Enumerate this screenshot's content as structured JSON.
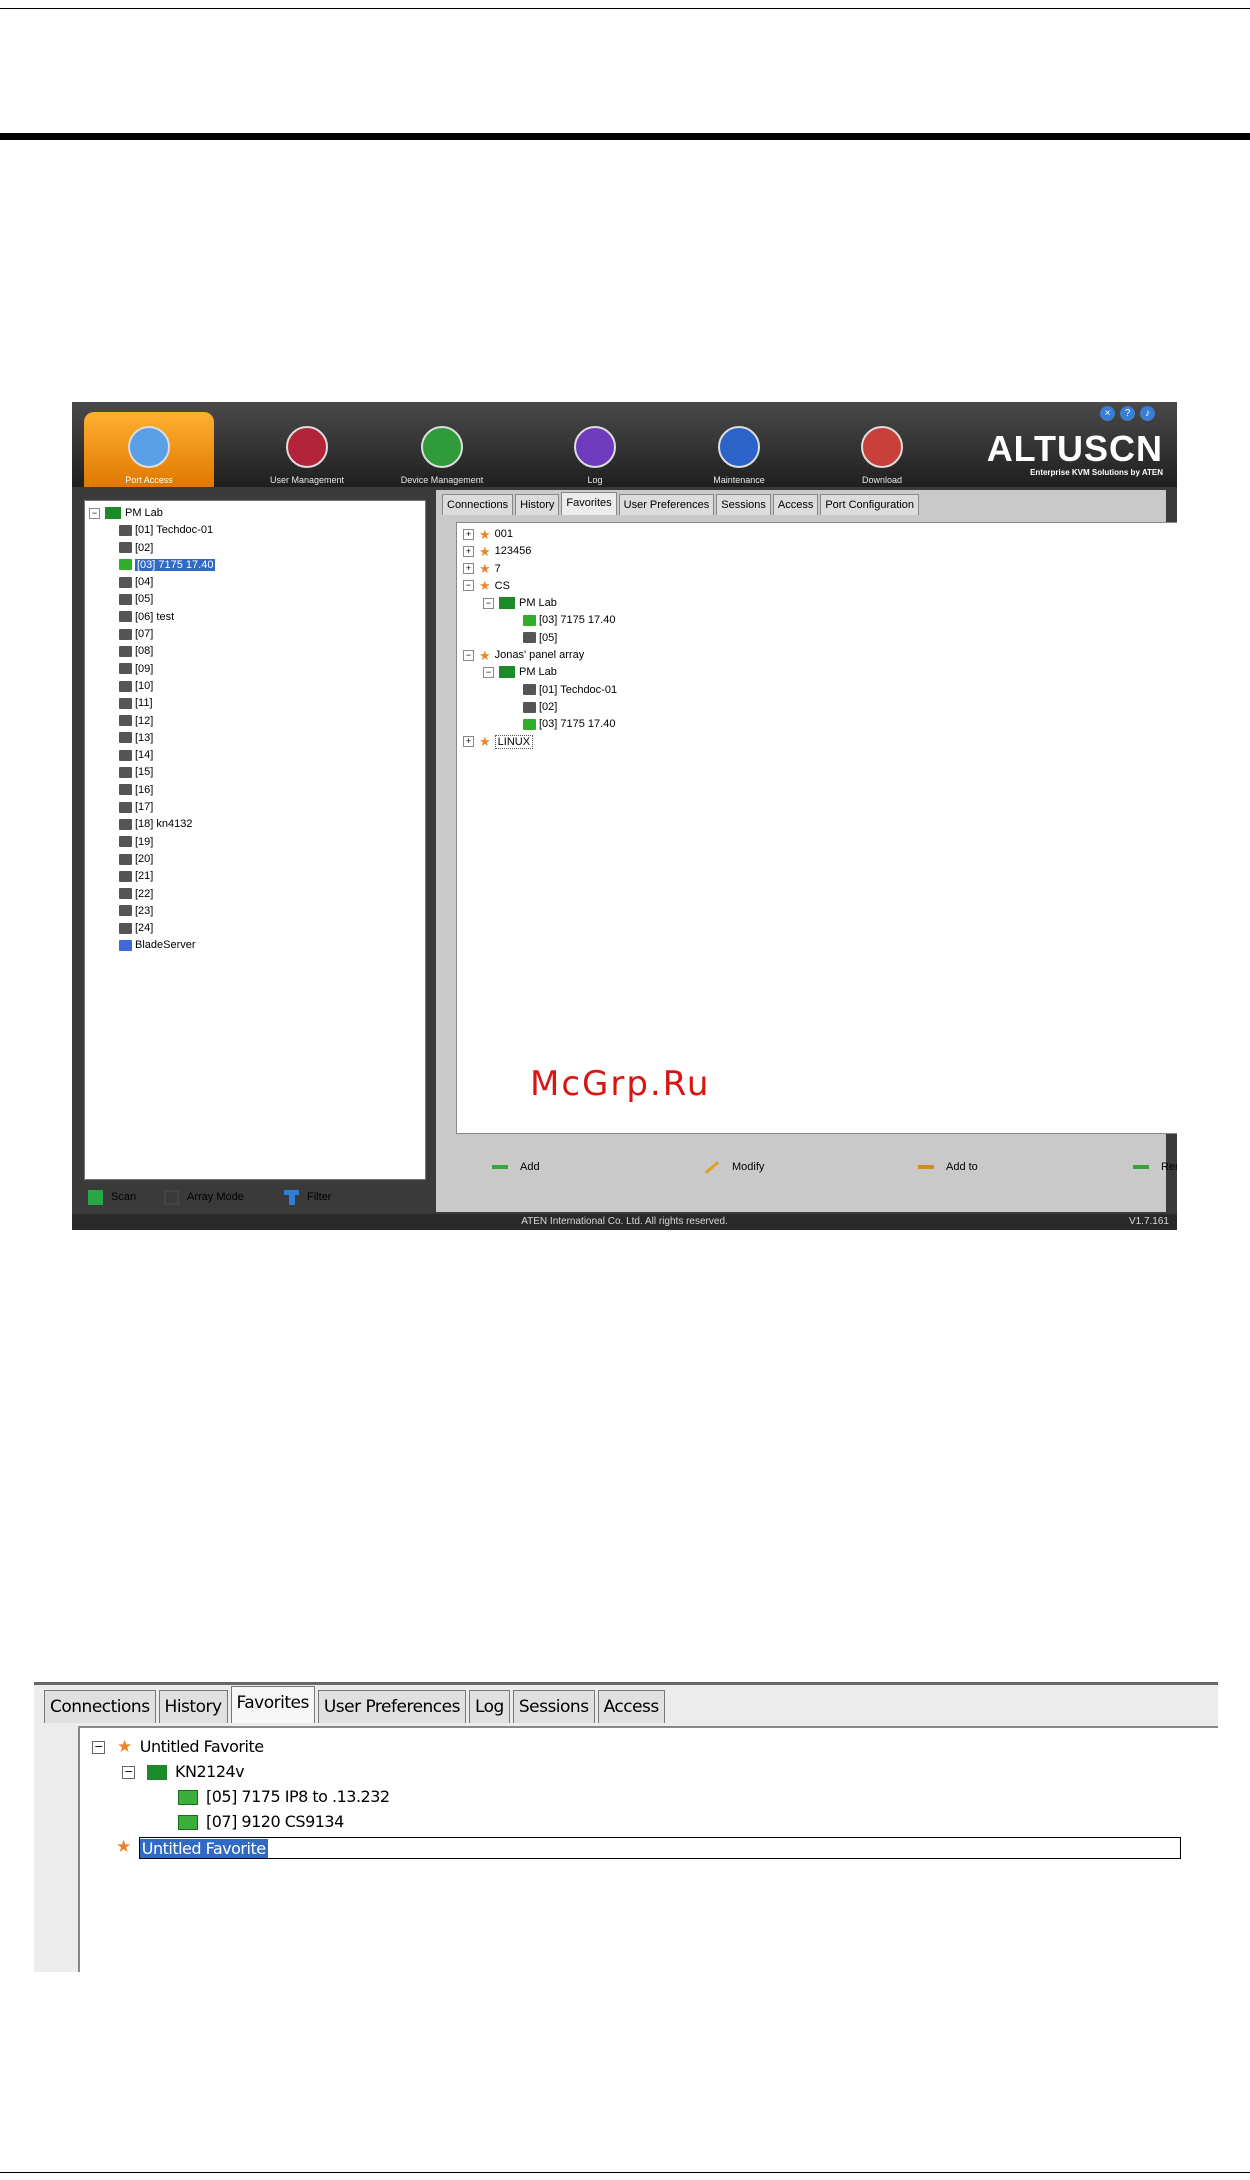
{
  "main_window": {
    "nav": [
      {
        "label": "Port Access",
        "active": true,
        "icon": "port-access-icon"
      },
      {
        "label": "User Management",
        "active": false,
        "icon": "user-management-icon"
      },
      {
        "label": "Device Management",
        "active": false,
        "icon": "device-management-icon"
      },
      {
        "label": "Log",
        "active": false,
        "icon": "log-icon"
      },
      {
        "label": "Maintenance",
        "active": false,
        "icon": "maintenance-icon"
      },
      {
        "label": "Download",
        "active": false,
        "icon": "download-icon"
      }
    ],
    "logo": {
      "name": "ALTUSCN",
      "tagline": "Enterprise KVM Solutions by ATEN"
    },
    "left_tree": {
      "root": "PM Lab",
      "ports": [
        "[01] Techdoc-01",
        "[02]",
        "[03] 7175 17.40",
        "[04]",
        "[05]",
        "[06] test",
        "[07]",
        "[08]",
        "[09]",
        "[10]",
        "[11]",
        "[12]",
        "[13]",
        "[14]",
        "[15]",
        "[16]",
        "[17]",
        "[18] kn4132",
        "[19]",
        "[20]",
        "[21]",
        "[22]",
        "[23]",
        "[24]"
      ],
      "blade": "BladeServer",
      "selected": "[03] 7175 17.40"
    },
    "left_actions": {
      "scan": "Scan",
      "array_mode": "Array Mode",
      "filter": "Filter"
    },
    "tabs": [
      "Connections",
      "History",
      "Favorites",
      "User Preferences",
      "Sessions",
      "Access",
      "Port Configuration"
    ],
    "active_tab": "Favorites",
    "favorites_tree": {
      "f001": "001",
      "f123456": "123456",
      "f7": "7",
      "cs": "CS",
      "cs_group": "PM Lab",
      "cs_port1": "[03] 7175 17.40",
      "cs_port2": "[05]",
      "jonas": "Jonas' panel array",
      "jonas_group": "PM Lab",
      "jonas_port1": "[01] Techdoc-01",
      "jonas_port2": "[02]",
      "jonas_port3": "[03] 7175 17.40",
      "linux": "LINUX"
    },
    "actions": {
      "add": "Add",
      "modify": "Modify",
      "add_to": "Add to",
      "remove": "Remove"
    },
    "status": {
      "copyright": "ATEN International Co. Ltd. All rights reserved.",
      "version": "V1.7.161"
    }
  },
  "watermark": "McGrp.Ru",
  "detail_window": {
    "tabs": [
      "Connections",
      "History",
      "Favorites",
      "User Preferences",
      "Log",
      "Sessions",
      "Access"
    ],
    "active_tab": "Favorites",
    "tree": {
      "favorite1": "Untitled Favorite",
      "device": "KN2124v",
      "port1": "[05] 7175 IP8 to .13.232",
      "port2": "[07] 9120 CS9134",
      "favorite2_edit": "Untitled Favorite"
    }
  },
  "colors": {
    "accent_orange": "#f29a1e",
    "selection_blue": "#316ac5",
    "star_orange": "#e8842a",
    "online_green": "#2fae2a"
  }
}
